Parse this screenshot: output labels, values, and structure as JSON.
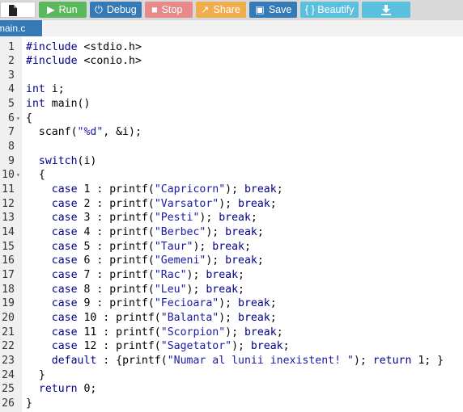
{
  "toolbar": {
    "run_label": "Run",
    "debug_label": "Debug",
    "stop_label": "Stop",
    "share_label": "Share",
    "save_label": "Save",
    "beautify_label": "{ } Beautify",
    "icons": [
      "file-icon",
      "play-icon",
      "debug-icon",
      "stop-icon",
      "share-icon",
      "save-icon",
      "download-icon"
    ]
  },
  "tab": {
    "label": "main.c"
  },
  "colors": {
    "run": "#5cb85c",
    "debug": "#337ab7",
    "stop": "#e88a8a",
    "share": "#f0ad4e",
    "save": "#337ab7",
    "beautify": "#5bc0de",
    "keyword": "#00008b",
    "string": "#1a1aa6"
  },
  "editor": {
    "lines": [
      {
        "n": "1",
        "fold": "",
        "segs": [
          [
            "kw",
            "#include"
          ],
          [
            "t",
            " <stdio.h>"
          ]
        ]
      },
      {
        "n": "2",
        "fold": "",
        "segs": [
          [
            "kw",
            "#include"
          ],
          [
            "t",
            " <conio.h>"
          ]
        ]
      },
      {
        "n": "3",
        "fold": "",
        "segs": []
      },
      {
        "n": "4",
        "fold": "",
        "segs": [
          [
            "kw",
            "int"
          ],
          [
            "t",
            " i;"
          ]
        ]
      },
      {
        "n": "5",
        "fold": "",
        "segs": [
          [
            "kw",
            "int"
          ],
          [
            "t",
            " main()"
          ]
        ]
      },
      {
        "n": "6",
        "fold": "▾",
        "segs": [
          [
            "t",
            "{"
          ]
        ]
      },
      {
        "n": "7",
        "fold": "",
        "segs": [
          [
            "t",
            "  scanf("
          ],
          [
            "str",
            "\"%d\""
          ],
          [
            "t",
            ", &i);"
          ]
        ]
      },
      {
        "n": "8",
        "fold": "",
        "segs": []
      },
      {
        "n": "9",
        "fold": "",
        "segs": [
          [
            "t",
            "  "
          ],
          [
            "kw",
            "switch"
          ],
          [
            "t",
            "(i)"
          ]
        ]
      },
      {
        "n": "10",
        "fold": "▾",
        "segs": [
          [
            "t",
            "  {"
          ]
        ]
      },
      {
        "n": "11",
        "fold": "",
        "segs": [
          [
            "t",
            "    "
          ],
          [
            "kw",
            "case"
          ],
          [
            "t",
            " 1 : printf("
          ],
          [
            "str",
            "\"Capricorn\""
          ],
          [
            "t",
            "); "
          ],
          [
            "kw",
            "break"
          ],
          [
            "t",
            ";"
          ]
        ]
      },
      {
        "n": "12",
        "fold": "",
        "segs": [
          [
            "t",
            "    "
          ],
          [
            "kw",
            "case"
          ],
          [
            "t",
            " 2 : printf("
          ],
          [
            "str",
            "\"Varsator\""
          ],
          [
            "t",
            "); "
          ],
          [
            "kw",
            "break"
          ],
          [
            "t",
            ";"
          ]
        ]
      },
      {
        "n": "13",
        "fold": "",
        "segs": [
          [
            "t",
            "    "
          ],
          [
            "kw",
            "case"
          ],
          [
            "t",
            " 3 : printf("
          ],
          [
            "str",
            "\"Pesti\""
          ],
          [
            "t",
            "); "
          ],
          [
            "kw",
            "break"
          ],
          [
            "t",
            ";"
          ]
        ]
      },
      {
        "n": "14",
        "fold": "",
        "segs": [
          [
            "t",
            "    "
          ],
          [
            "kw",
            "case"
          ],
          [
            "t",
            " 4 : printf("
          ],
          [
            "str",
            "\"Berbec\""
          ],
          [
            "t",
            "); "
          ],
          [
            "kw",
            "break"
          ],
          [
            "t",
            ";"
          ]
        ]
      },
      {
        "n": "15",
        "fold": "",
        "segs": [
          [
            "t",
            "    "
          ],
          [
            "kw",
            "case"
          ],
          [
            "t",
            " 5 : printf("
          ],
          [
            "str",
            "\"Taur\""
          ],
          [
            "t",
            "); "
          ],
          [
            "kw",
            "break"
          ],
          [
            "t",
            ";"
          ]
        ]
      },
      {
        "n": "16",
        "fold": "",
        "segs": [
          [
            "t",
            "    "
          ],
          [
            "kw",
            "case"
          ],
          [
            "t",
            " 6 : printf("
          ],
          [
            "str",
            "\"Gemeni\""
          ],
          [
            "t",
            "); "
          ],
          [
            "kw",
            "break"
          ],
          [
            "t",
            ";"
          ]
        ]
      },
      {
        "n": "17",
        "fold": "",
        "segs": [
          [
            "t",
            "    "
          ],
          [
            "kw",
            "case"
          ],
          [
            "t",
            " 7 : printf("
          ],
          [
            "str",
            "\"Rac\""
          ],
          [
            "t",
            "); "
          ],
          [
            "kw",
            "break"
          ],
          [
            "t",
            ";"
          ]
        ]
      },
      {
        "n": "18",
        "fold": "",
        "segs": [
          [
            "t",
            "    "
          ],
          [
            "kw",
            "case"
          ],
          [
            "t",
            " 8 : printf("
          ],
          [
            "str",
            "\"Leu\""
          ],
          [
            "t",
            "); "
          ],
          [
            "kw",
            "break"
          ],
          [
            "t",
            ";"
          ]
        ]
      },
      {
        "n": "19",
        "fold": "",
        "segs": [
          [
            "t",
            "    "
          ],
          [
            "kw",
            "case"
          ],
          [
            "t",
            " 9 : printf("
          ],
          [
            "str",
            "\"Fecioara\""
          ],
          [
            "t",
            "); "
          ],
          [
            "kw",
            "break"
          ],
          [
            "t",
            ";"
          ]
        ]
      },
      {
        "n": "20",
        "fold": "",
        "segs": [
          [
            "t",
            "    "
          ],
          [
            "kw",
            "case"
          ],
          [
            "t",
            " 10 : printf("
          ],
          [
            "str",
            "\"Balanta\""
          ],
          [
            "t",
            "); "
          ],
          [
            "kw",
            "break"
          ],
          [
            "t",
            ";"
          ]
        ]
      },
      {
        "n": "21",
        "fold": "",
        "segs": [
          [
            "t",
            "    "
          ],
          [
            "kw",
            "case"
          ],
          [
            "t",
            " 11 : printf("
          ],
          [
            "str",
            "\"Scorpion\""
          ],
          [
            "t",
            "); "
          ],
          [
            "kw",
            "break"
          ],
          [
            "t",
            ";"
          ]
        ]
      },
      {
        "n": "22",
        "fold": "",
        "segs": [
          [
            "t",
            "    "
          ],
          [
            "kw",
            "case"
          ],
          [
            "t",
            " 12 : printf("
          ],
          [
            "str",
            "\"Sagetator\""
          ],
          [
            "t",
            "); "
          ],
          [
            "kw",
            "break"
          ],
          [
            "t",
            ";"
          ]
        ]
      },
      {
        "n": "23",
        "fold": "",
        "segs": [
          [
            "t",
            "    "
          ],
          [
            "kw",
            "default"
          ],
          [
            "t",
            " : {printf("
          ],
          [
            "str",
            "\"Numar al lunii inexistent! \""
          ],
          [
            "t",
            "); "
          ],
          [
            "kw",
            "return"
          ],
          [
            "t",
            " 1; }"
          ]
        ]
      },
      {
        "n": "24",
        "fold": "",
        "segs": [
          [
            "t",
            "  }"
          ]
        ]
      },
      {
        "n": "25",
        "fold": "",
        "segs": [
          [
            "t",
            "  "
          ],
          [
            "kw",
            "return"
          ],
          [
            "t",
            " 0;"
          ]
        ]
      },
      {
        "n": "26",
        "fold": "",
        "segs": [
          [
            "t",
            "}"
          ]
        ]
      }
    ]
  }
}
